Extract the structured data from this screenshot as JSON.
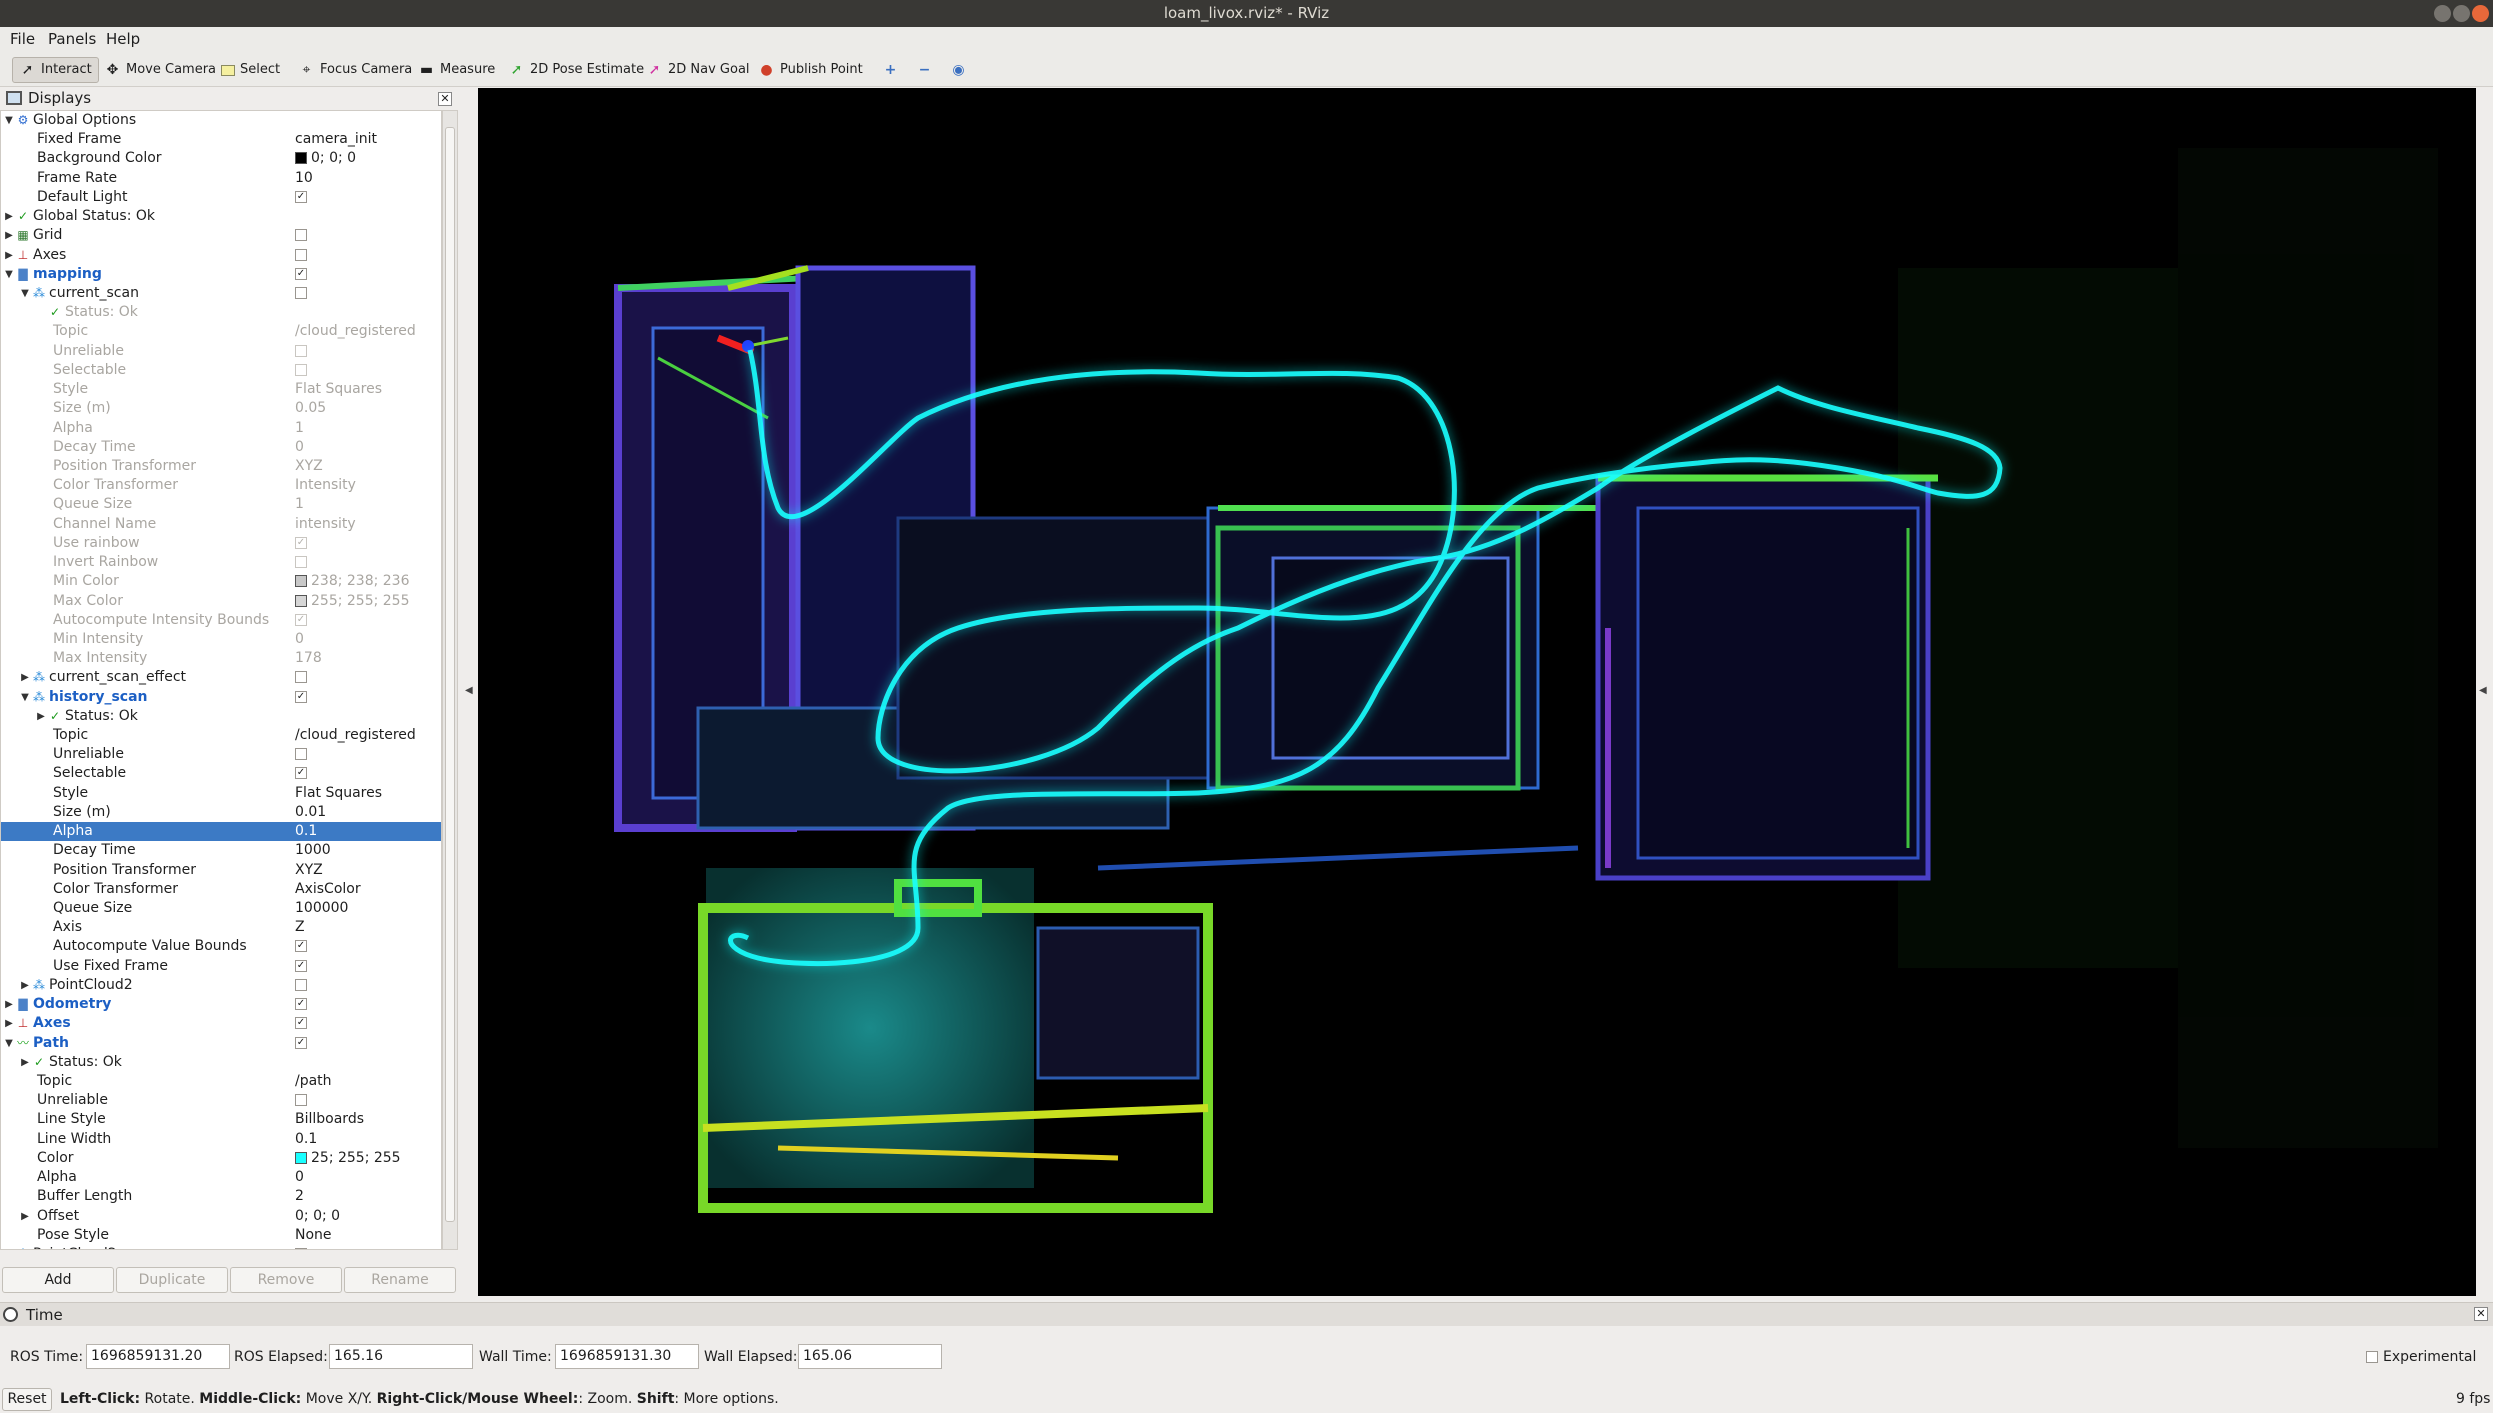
{
  "window": {
    "title": "loam_livox.rviz* - RViz"
  },
  "menu": {
    "file": "File",
    "panels": "Panels",
    "help": "Help"
  },
  "toolbar": {
    "interact": "Interact",
    "move_camera": "Move Camera",
    "select": "Select",
    "focus_camera": "Focus Camera",
    "measure": "Measure",
    "pose_estimate": "2D Pose Estimate",
    "nav_goal": "2D Nav Goal",
    "publish_point": "Publish Point"
  },
  "displays": {
    "title": "Displays",
    "global_options": "Global Options",
    "fixed_frame_label": "Fixed Frame",
    "fixed_frame": "camera_init",
    "background_color_label": "Background Color",
    "background_color": "0; 0; 0",
    "frame_rate_label": "Frame Rate",
    "frame_rate": "10",
    "default_light_label": "Default Light",
    "global_status": "Global Status: Ok",
    "grid": "Grid",
    "axes": "Axes",
    "mapping": "mapping",
    "current_scan": "current_scan",
    "status_ok": "Status: Ok",
    "topic_label": "Topic",
    "topic_cloud": "/cloud_registered",
    "unreliable_label": "Unreliable",
    "selectable_label": "Selectable",
    "style_label": "Style",
    "style_flat": "Flat Squares",
    "size_label": "Size (m)",
    "cs_size": "0.05",
    "alpha_label": "Alpha",
    "cs_alpha": "1",
    "decay_label": "Decay Time",
    "cs_decay": "0",
    "pos_tf_label": "Position Transformer",
    "pos_tf": "XYZ",
    "color_tf_label": "Color Transformer",
    "cs_color_tf": "Intensity",
    "queue_label": "Queue Size",
    "cs_queue": "1",
    "channel_label": "Channel Name",
    "channel": "intensity",
    "use_rainbow_label": "Use rainbow",
    "invert_rainbow_label": "Invert Rainbow",
    "min_color_label": "Min Color",
    "min_color": "238; 238; 236",
    "max_color_label": "Max Color",
    "max_color": "255; 255; 255",
    "auto_int_label": "Autocompute Intensity Bounds",
    "min_int_label": "Min Intensity",
    "min_int": "0",
    "max_int_label": "Max Intensity",
    "max_int": "178",
    "current_scan_effect": "current_scan_effect",
    "history_scan": "history_scan",
    "hs_size": "0.01",
    "hs_alpha": "0.1",
    "hs_decay": "1000",
    "hs_color_tf": "AxisColor",
    "hs_queue": "100000",
    "axis_label": "Axis",
    "axis": "Z",
    "auto_val_label": "Autocompute Value Bounds",
    "fixed_frame_use_label": "Use Fixed Frame",
    "pointcloud2": "PointCloud2",
    "odometry": "Odometry",
    "path": "Path",
    "topic_path": "/path",
    "line_style_label": "Line Style",
    "line_style": "Billboards",
    "line_width_label": "Line Width",
    "line_width": "0.1",
    "color_label": "Color",
    "path_color": "25; 255; 255",
    "path_alpha": "0",
    "buffer_label": "Buffer Length",
    "buffer": "2",
    "offset_label": "Offset",
    "offset": "0; 0; 0",
    "pose_style_label": "Pose Style",
    "pose_style": "None"
  },
  "panel_buttons": {
    "add": "Add",
    "duplicate": "Duplicate",
    "remove": "Remove",
    "rename": "Rename"
  },
  "time": {
    "title": "Time",
    "ros_time_label": "ROS Time:",
    "ros_time": "1696859131.20",
    "ros_elapsed_label": "ROS Elapsed:",
    "ros_elapsed": "165.16",
    "wall_time_label": "Wall Time:",
    "wall_time": "1696859131.30",
    "wall_elapsed_label": "Wall Elapsed:",
    "wall_elapsed": "165.06",
    "experimental": "Experimental"
  },
  "status": {
    "reset": "Reset",
    "k1": "Left-Click:",
    "t1": " Rotate. ",
    "k2": "Middle-Click:",
    "t2": " Move X/Y. ",
    "k3": "Right-Click/Mouse Wheel:",
    "t3": ": Zoom. ",
    "k4": "Shift",
    "t4": ": More options.",
    "fps": "9 fps"
  },
  "colors": {
    "path": "#19ffff",
    "accent": "#3c7ac5"
  }
}
